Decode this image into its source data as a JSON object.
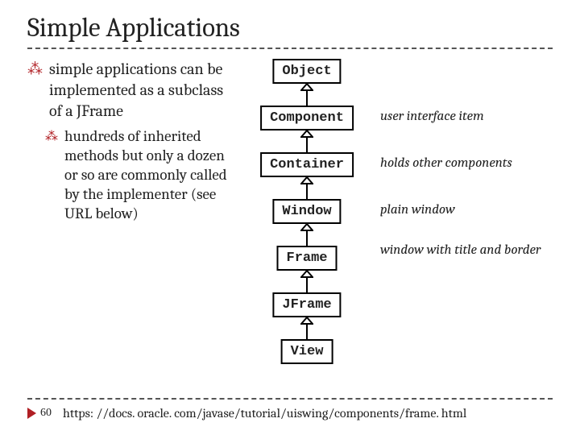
{
  "title": "Simple Applications",
  "bullet1": "simple applications can be implemented as a subclass of a JFrame",
  "sub1": "hundreds of inherited methods but only a dozen or so are commonly called by the implementer (see URL below)",
  "nodes": [
    "Object",
    "Component",
    "Container",
    "Window",
    "Frame",
    "JFrame",
    "View"
  ],
  "notes": {
    "component": "user interface item",
    "container": "holds other components",
    "window": "plain window",
    "frame": "window with title and border"
  },
  "footer": {
    "page": "60",
    "link": "https: //docs. oracle. com/javase/tutorial/uiswing/components/frame. html"
  },
  "bullet_glyph": "⁂"
}
